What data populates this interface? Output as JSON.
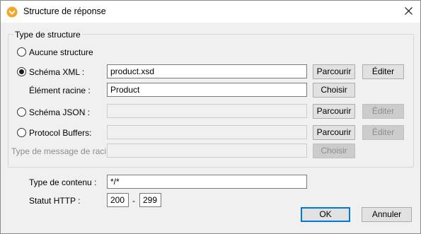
{
  "window": {
    "title": "Structure de réponse"
  },
  "group": {
    "legend": "Type de structure",
    "options": {
      "none": "Aucune structure",
      "xml": "Schéma XML :",
      "json": "Schéma JSON :",
      "protobuf": "Protocol Buffers:"
    },
    "xml_value": "product.xsd",
    "root_label": "Élément racine :",
    "root_value": "Product",
    "message_root_label": "Type de message de racine",
    "browse": "Parcourir",
    "edit": "Éditer",
    "choose": "Choisir",
    "selected": "xml"
  },
  "content_type": {
    "label": "Type de contenu :",
    "value": "*/*"
  },
  "http_status": {
    "label": "Statut HTTP :",
    "from": "200",
    "separator": "-",
    "to": "299"
  },
  "footer": {
    "ok": "OK",
    "cancel": "Annuler"
  },
  "colors": {
    "icon_orange": "#f5a623",
    "accent": "#0078d7"
  }
}
